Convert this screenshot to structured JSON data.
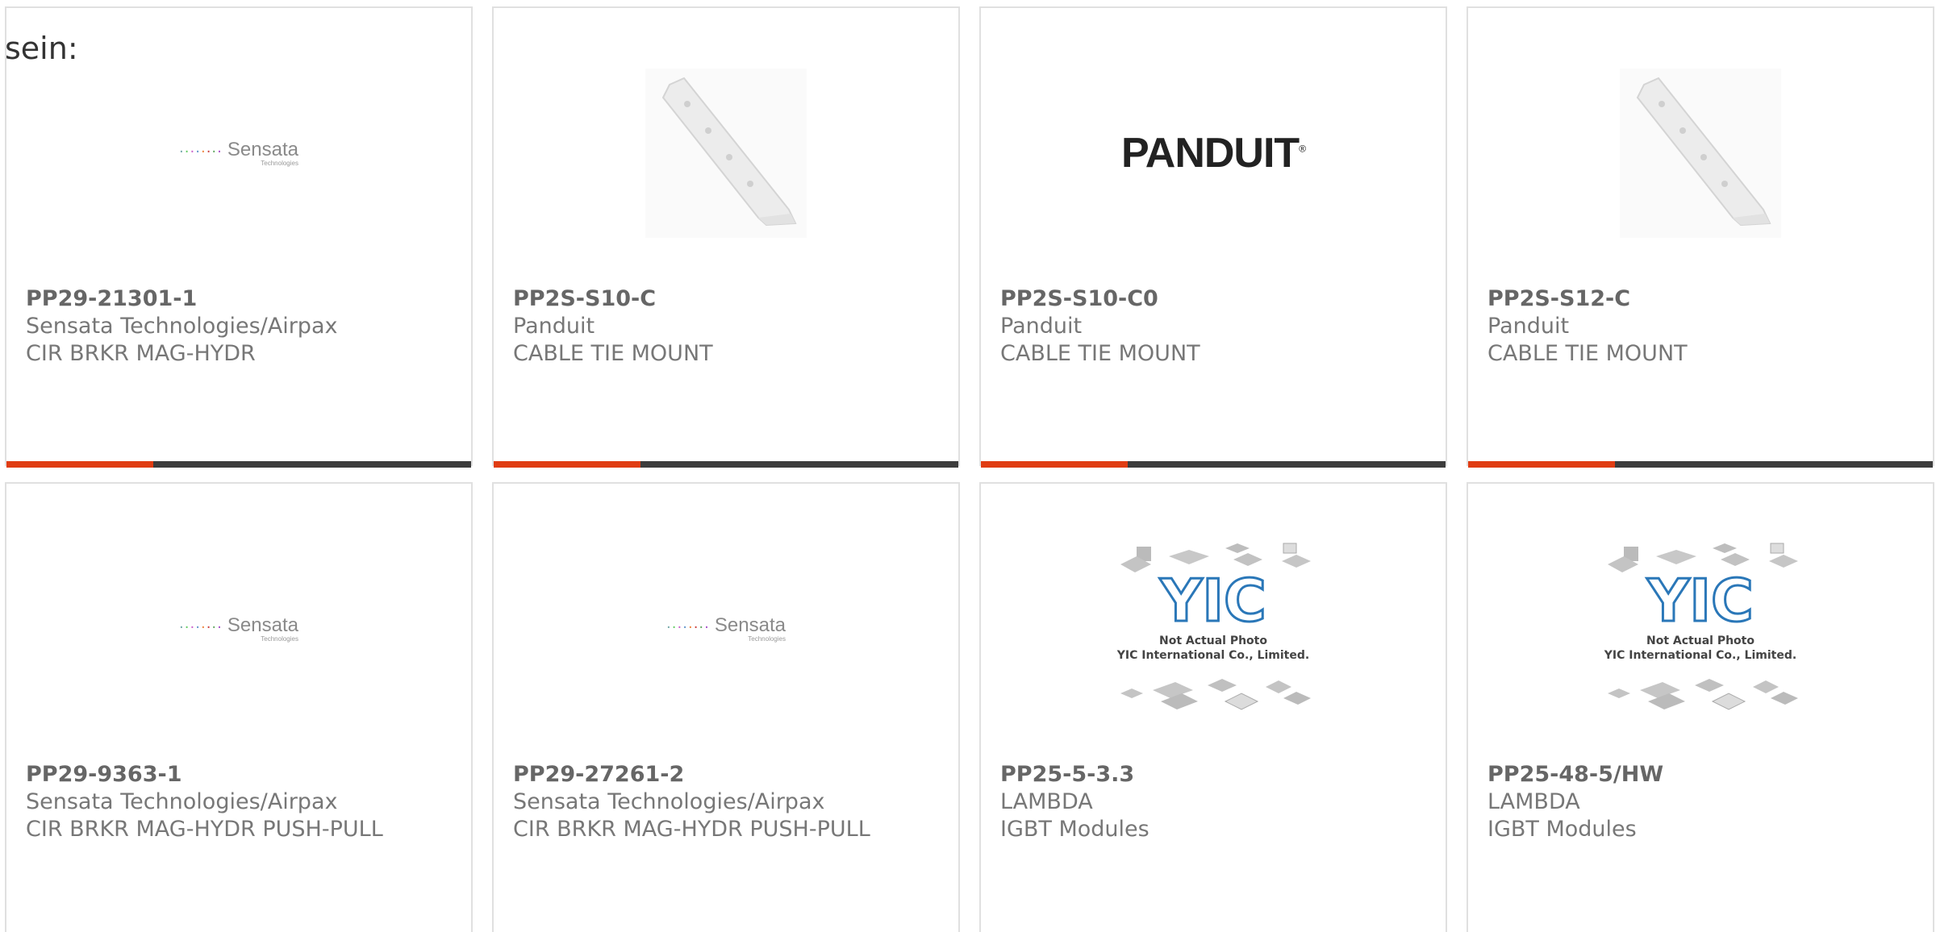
{
  "intro": {
    "text": "sein:"
  },
  "colors": {
    "accent": "#e03c12",
    "bar": "#3c3c3c",
    "border": "#e0e0e0"
  },
  "products": [
    {
      "part": "PP29-21301-1",
      "manufacturer": "Sensata Technologies/Airpax",
      "description": "CIR BRKR MAG-HYDR",
      "image": "sensata-logo"
    },
    {
      "part": "PP2S-S10-C",
      "manufacturer": "Panduit",
      "description": "CABLE TIE MOUNT",
      "image": "cable-tie-mount-photo"
    },
    {
      "part": "PP2S-S10-C0",
      "manufacturer": "Panduit",
      "description": "CABLE TIE MOUNT",
      "image": "panduit-logo"
    },
    {
      "part": "PP2S-S12-C",
      "manufacturer": "Panduit",
      "description": "CABLE TIE MOUNT",
      "image": "cable-tie-mount-photo"
    },
    {
      "part": "PP29-9363-1",
      "manufacturer": "Sensata Technologies/Airpax",
      "description": "CIR BRKR MAG-HYDR PUSH-PULL",
      "image": "sensata-logo"
    },
    {
      "part": "PP29-27261-2",
      "manufacturer": "Sensata Technologies/Airpax",
      "description": "CIR BRKR MAG-HYDR PUSH-PULL",
      "image": "sensata-logo"
    },
    {
      "part": "PP25-5-3.3",
      "manufacturer": "LAMBDA",
      "description": "IGBT Modules",
      "image": "yic-placeholder"
    },
    {
      "part": "PP25-48-5/HW",
      "manufacturer": "LAMBDA",
      "description": "IGBT Modules",
      "image": "yic-placeholder"
    }
  ],
  "logos": {
    "sensata_name": "Sensata",
    "sensata_sub": "Technologies",
    "panduit_name": "PANDUIT",
    "panduit_reg": "®",
    "yic_line1": "Not Actual Photo",
    "yic_line2": "YIC International Co., Limited."
  }
}
